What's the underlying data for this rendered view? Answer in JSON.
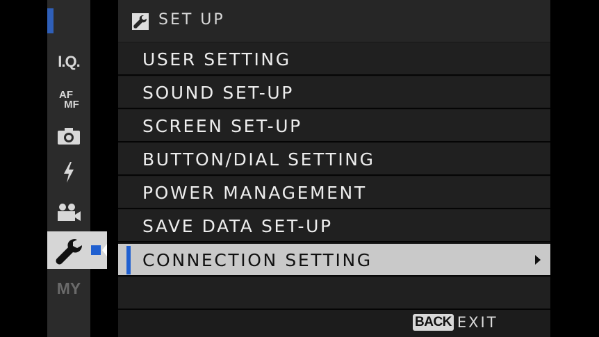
{
  "sidebar": {
    "tabs": [
      {
        "name": "I.Q."
      },
      {
        "name_top": "AF",
        "name_bottom": "MF"
      },
      {
        "icon": "camera-icon"
      },
      {
        "icon": "flash-icon"
      },
      {
        "icon": "movie-camera-icon"
      },
      {
        "icon": "wrench-icon",
        "active": true
      },
      {
        "name": "MY"
      }
    ]
  },
  "header": {
    "icon": "wrench-icon",
    "title": "SET UP"
  },
  "menu": {
    "items": [
      {
        "label": "USER SETTING"
      },
      {
        "label": "SOUND SET-UP"
      },
      {
        "label": "SCREEN SET-UP"
      },
      {
        "label": "BUTTON/DIAL SETTING"
      },
      {
        "label": "POWER MANAGEMENT"
      },
      {
        "label": "SAVE DATA SET-UP"
      },
      {
        "label": "CONNECTION SETTING",
        "selected": true,
        "has_submenu": true
      }
    ]
  },
  "footer": {
    "back_button": "BACK",
    "action": "EXIT"
  },
  "colors": {
    "accent": "#1f5fd0",
    "selected_row": "#c9c9c9",
    "row_background": "#202020",
    "sidebar_background": "#2b2b2b"
  }
}
